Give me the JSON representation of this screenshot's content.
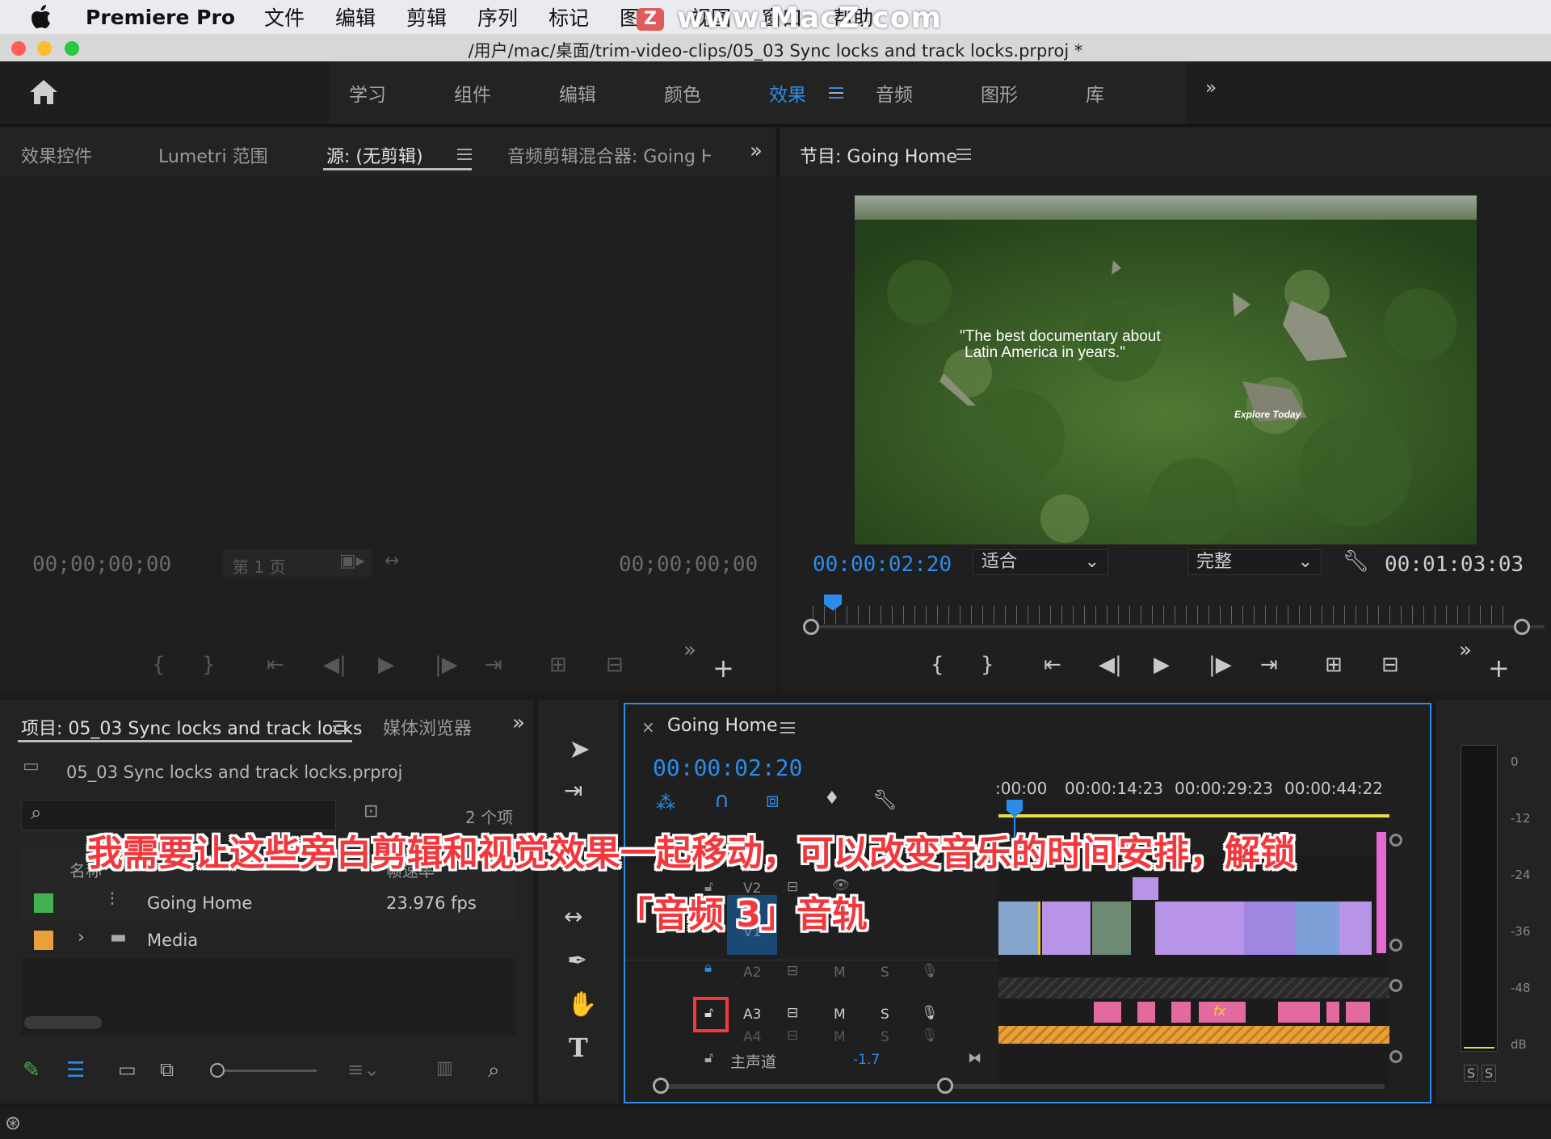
{
  "menubar": {
    "app": "Premiere Pro",
    "items": [
      "文件",
      "编辑",
      "剪辑",
      "序列",
      "标记",
      "图形",
      "视图",
      "窗口",
      "帮助"
    ],
    "watermark": "www.MacZ.com",
    "watermark_logo": "Z"
  },
  "window": {
    "title": "/用户/mac/桌面/trim-video-clips/05_03 Sync locks and track locks.prproj *"
  },
  "workspaces": {
    "items": [
      "学习",
      "组件",
      "编辑",
      "颜色",
      "效果",
      "音频",
      "图形",
      "库"
    ],
    "active": "效果"
  },
  "source_panel": {
    "tabs": [
      "效果控件",
      "Lumetri 范围",
      "源: (无剪辑)",
      "音频剪辑混合器: Going H"
    ],
    "active_tab": "源: (无剪辑)",
    "tc_left": "00;00;00;00",
    "tc_right": "00;00;00;00",
    "page": "第 1 页"
  },
  "program_panel": {
    "title": "节目: Going Home",
    "timecode": "00:00:02:20",
    "fit": "适合",
    "quality": "完整",
    "duration": "00:01:03:03",
    "video_text1": "\"The best documentary about",
    "video_text2": "Latin America in years.\"",
    "video_text3": "Explore Today"
  },
  "project_panel": {
    "title": "项目: 05_03 Sync locks and track locks",
    "tab2": "媒体浏览器",
    "file": "05_03 Sync locks and track locks.prproj",
    "count": "2 个项",
    "col_name": "名称",
    "col_fps": "帧速率",
    "items": [
      {
        "name": "Going Home",
        "fps": "23.976 fps",
        "color": "#3fb34f"
      },
      {
        "name": "Media",
        "fps": "",
        "color": "#e8a13a"
      }
    ]
  },
  "timeline": {
    "title": "Going Home",
    "timecode": "00:00:02:20",
    "ruler": [
      ":00:00",
      "00:00:14:23",
      "00:00:29:23",
      "00:00:44:22"
    ],
    "tracks": {
      "v2": "V2",
      "v1": "V1",
      "a2": "A2",
      "a3": "A3",
      "a4": "A4",
      "master": "主声道",
      "master_val": "-1.7"
    },
    "m": "M",
    "s": "S"
  },
  "meter": {
    "scale": [
      "0",
      "-12",
      "-24",
      "-36",
      "-48",
      "dB"
    ],
    "solo": "S"
  },
  "caption": {
    "line1": "我需要让这些旁白剪辑和视觉效果一起移动，可以改变音乐的时间安排，解锁",
    "line2": "「音频 3」音轨"
  },
  "colors": {
    "accent": "#2d8ceb",
    "clip_purple": "#b794e8",
    "clip_pink": "#e36aa0",
    "clip_orange": "#e8a13a",
    "highlight": "#f2383d"
  }
}
